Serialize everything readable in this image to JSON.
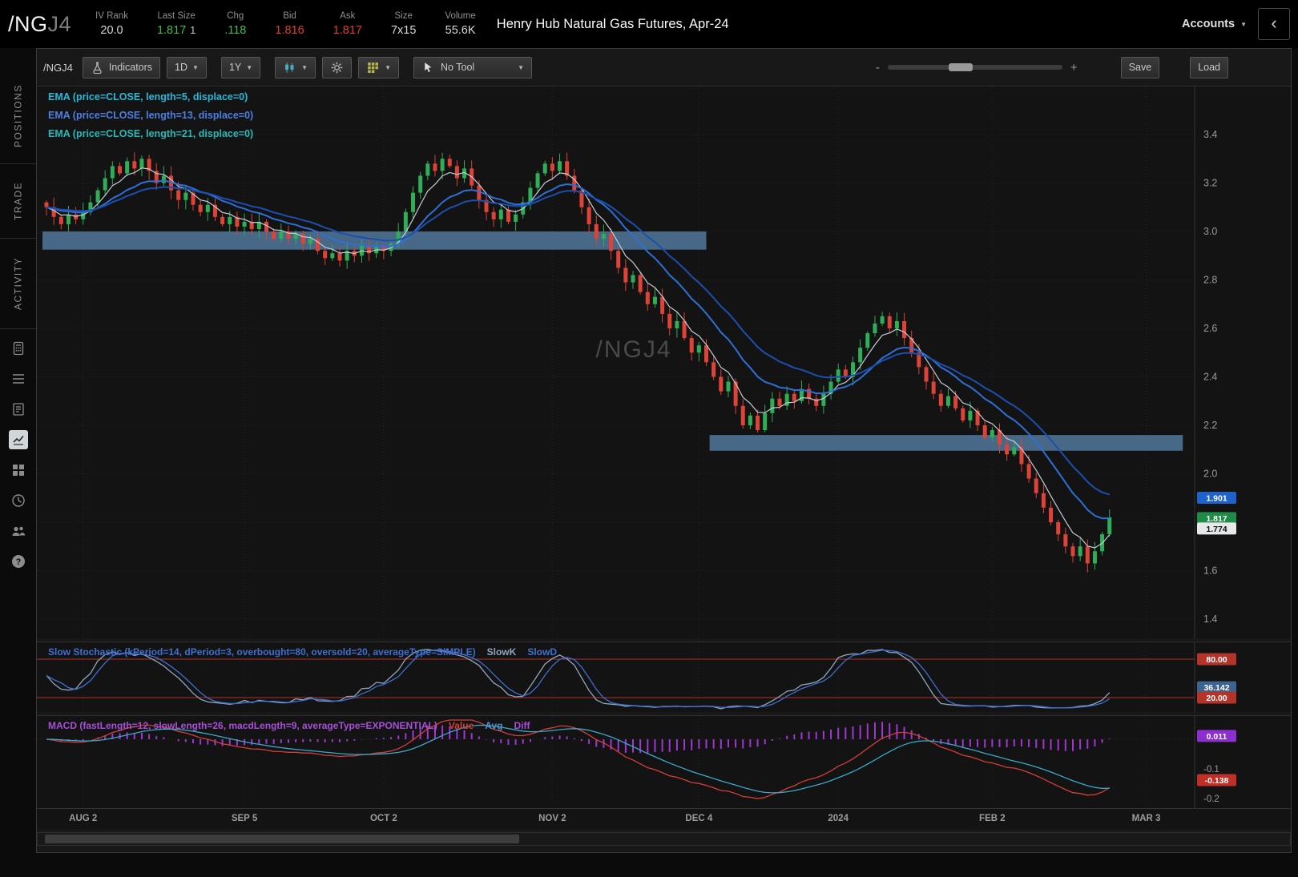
{
  "header": {
    "symbol": "/NG",
    "symbol_suffix": "J4",
    "stats": [
      {
        "label": "IV Rank",
        "value": "20.0",
        "color": "#d8d8d8"
      },
      {
        "label": "Last Size",
        "value": "1.817",
        "extra": "1",
        "color": "#3dbd4e"
      },
      {
        "label": "Chg",
        "value": ".118",
        "color": "#3dbd4e"
      },
      {
        "label": "Bid",
        "value": "1.816",
        "color": "#e23b2e"
      },
      {
        "label": "Ask",
        "value": "1.817",
        "color": "#e23b2e"
      },
      {
        "label": "Size",
        "value": "7x15",
        "color": "#d8d8d8"
      },
      {
        "label": "Volume",
        "value": "55.6K",
        "color": "#d8d8d8"
      }
    ],
    "title": "Henry Hub Natural Gas Futures, Apr-24",
    "accounts_label": "Accounts",
    "collapse_icon": "‹"
  },
  "sidebar": {
    "tabs": [
      {
        "label": "POSITIONS"
      },
      {
        "label": "TRADE"
      },
      {
        "label": "ACTIVITY"
      }
    ],
    "icons": [
      "calculator-icon",
      "watchlist-icon",
      "notes-icon",
      "chart-icon",
      "grid-icon",
      "history-icon",
      "contacts-icon",
      "help-icon"
    ]
  },
  "toolbar": {
    "symbol": "/NGJ4",
    "indicators": "Indicators",
    "timeframe": "1D",
    "range": "1Y",
    "tool": "No Tool",
    "zoom_minus": "-",
    "zoom_plus": "+",
    "save": "Save",
    "load": "Load"
  },
  "main_chart": {
    "ema_labels": [
      {
        "text": "EMA (price=CLOSE, length=5, displace=0)",
        "color": "#2ab8d8"
      },
      {
        "text": "EMA (price=CLOSE, length=13, displace=0)",
        "color": "#4f7fe0"
      },
      {
        "text": "EMA (price=CLOSE, length=21, displace=0)",
        "color": "#2ab8b8"
      }
    ],
    "watermark": "/NGJ4",
    "up_color": "#2fae58",
    "down_color": "#dd4336",
    "zone_color": "#4e7294",
    "price_tags": [
      {
        "text": "1.901",
        "price": 1.901,
        "bg": "#1f62c9",
        "fg": "#ffffff"
      },
      {
        "text": "1.817",
        "price": 1.817,
        "bg": "#1e8c46",
        "fg": "#ffffff"
      },
      {
        "text": "1.774",
        "price": 1.774,
        "bg": "#e6e8ea",
        "fg": "#111111"
      }
    ]
  },
  "stochastic": {
    "label": "Slow Stochastic (kPeriod=14, dPeriod=3, overbought=80, oversold=20, averageType=SIMPLE)",
    "label_color": "#3f6fd0",
    "slowk_label": "SlowK",
    "slowk_color": "#8fa6ba",
    "slowd_label": "SlowD",
    "slowd_color": "#3f6fd0",
    "overbought": 80,
    "oversold": 20,
    "level_color": "#b03028",
    "tags": [
      {
        "text": "80.00",
        "bg": "#b5342a",
        "fg": "#ffffff",
        "value": 80
      },
      {
        "text": "36.142",
        "bg": "#3d6491",
        "fg": "#ffffff",
        "value": 36.142
      },
      {
        "text": "20.00",
        "bg": "#b5342a",
        "fg": "#ffffff",
        "value": 20
      }
    ]
  },
  "macd": {
    "label": "MACD (fastLength=12, slowLength=26, macdLength=9, averageType=EXPONENTIAL)",
    "label_color": "#a84fd8",
    "value_label": "Value",
    "value_color": "#d04038",
    "avg_label": "Avg",
    "avg_color": "#4f8fd0",
    "avg_plot_color": "#3aa8c8",
    "diff_label": "Diff",
    "diff_color": "#a84fd8",
    "diff_plot_color": "#a335d6",
    "axis_ticks": [
      {
        "text": "-0.1",
        "value": -0.1
      },
      {
        "text": "-0.2",
        "value": -0.2
      }
    ],
    "tags": [
      {
        "text": "0.011",
        "bg": "#8c2fd0",
        "fg": "#ffffff",
        "value": 0.011
      },
      {
        "text": "-0.138",
        "bg": "#c03028",
        "fg": "#ffffff",
        "value": -0.138
      }
    ]
  },
  "chart_data": {
    "type": "candlestick",
    "symbol": "/NGJ4",
    "timeframe": "1D",
    "range": "1Y",
    "title": "Henry Hub Natural Gas Futures, Apr-24",
    "price_axis": {
      "min": 1.4,
      "max": 3.4,
      "step": 0.2
    },
    "last_price": 1.817,
    "closes": [
      3.1,
      3.06,
      3.03,
      3.07,
      3.05,
      3.08,
      3.12,
      3.17,
      3.22,
      3.27,
      3.24,
      3.29,
      3.26,
      3.3,
      3.25,
      3.2,
      3.23,
      3.17,
      3.13,
      3.16,
      3.11,
      3.08,
      3.11,
      3.06,
      3.03,
      3.06,
      3.02,
      3.04,
      3.01,
      3.04,
      3.0,
      2.97,
      3.0,
      2.97,
      2.99,
      2.95,
      2.97,
      2.92,
      2.89,
      2.91,
      2.88,
      2.92,
      2.9,
      2.94,
      2.91,
      2.94,
      2.92,
      2.95,
      3.0,
      3.08,
      3.16,
      3.23,
      3.28,
      3.25,
      3.3,
      3.27,
      3.22,
      3.26,
      3.19,
      3.13,
      3.08,
      3.05,
      3.09,
      3.04,
      3.07,
      3.12,
      3.18,
      3.24,
      3.28,
      3.25,
      3.29,
      3.23,
      3.17,
      3.1,
      3.03,
      2.97,
      2.99,
      2.92,
      2.85,
      2.79,
      2.82,
      2.75,
      2.7,
      2.73,
      2.66,
      2.6,
      2.63,
      2.56,
      2.5,
      2.53,
      2.46,
      2.4,
      2.34,
      2.38,
      2.28,
      2.2,
      2.24,
      2.18,
      2.25,
      2.31,
      2.28,
      2.33,
      2.3,
      2.35,
      2.31,
      2.28,
      2.33,
      2.38,
      2.43,
      2.4,
      2.46,
      2.52,
      2.58,
      2.62,
      2.65,
      2.6,
      2.63,
      2.56,
      2.5,
      2.44,
      2.38,
      2.33,
      2.28,
      2.32,
      2.27,
      2.22,
      2.26,
      2.2,
      2.15,
      2.18,
      2.12,
      2.08,
      2.11,
      2.04,
      1.98,
      1.92,
      1.86,
      1.8,
      1.75,
      1.7,
      1.66,
      1.7,
      1.63,
      1.68,
      1.75,
      1.82
    ],
    "x_labels": [
      {
        "label": "AUG 2",
        "day": 5
      },
      {
        "label": "SEP 5",
        "day": 27
      },
      {
        "label": "OCT 2",
        "day": 46
      },
      {
        "label": "NOV 2",
        "day": 69
      },
      {
        "label": "DEC 4",
        "day": 89
      },
      {
        "label": "2024",
        "day": 108
      },
      {
        "label": "FEB 2",
        "day": 129
      },
      {
        "label": "MAR 3",
        "day": 150
      }
    ],
    "zones": [
      {
        "from_day": 0,
        "to_day": 90,
        "top": 3.0,
        "bottom": 2.925
      },
      {
        "from_day": 91,
        "to_day": 155,
        "top": 2.16,
        "bottom": 2.095
      }
    ],
    "overlays": [
      {
        "name": "EMA5",
        "length": 5,
        "color": "#c4cdd6",
        "width": 1.2
      },
      {
        "name": "EMA13",
        "length": 13,
        "color": "#2f6fd6",
        "width": 2
      },
      {
        "name": "EMA21",
        "length": 21,
        "color": "#1c4fae",
        "width": 2
      }
    ],
    "studies": {
      "stochastic": {
        "kPeriod": 14,
        "dPeriod": 3,
        "overbought": 80,
        "oversold": 20,
        "last": 36.142
      },
      "macd": {
        "fast": 12,
        "slow": 26,
        "signal": 9,
        "last_value": -0.138,
        "last_diff": 0.011
      }
    }
  }
}
